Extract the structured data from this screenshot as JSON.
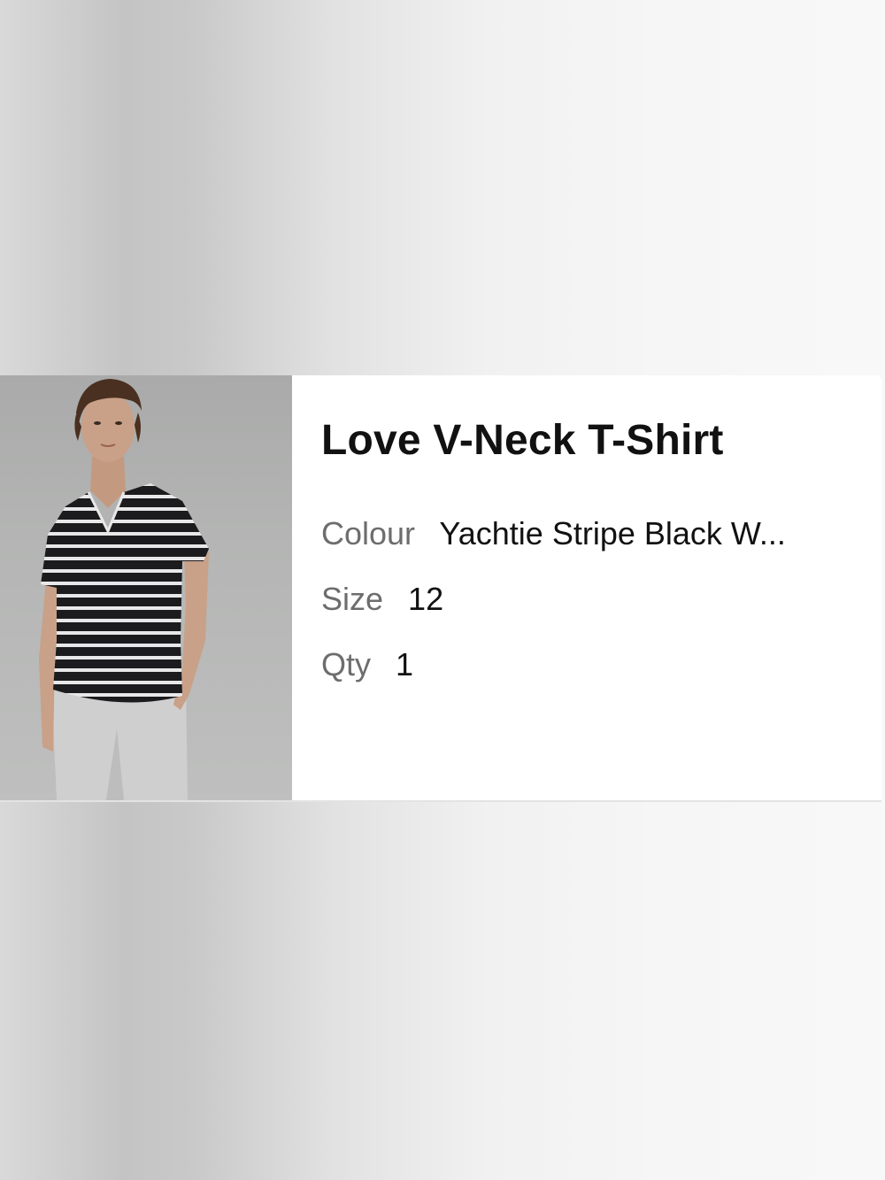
{
  "product": {
    "title": "Love V-Neck T-Shirt",
    "image_alt": "Model wearing striped v-neck t-shirt",
    "attributes": [
      {
        "label": "Colour",
        "value": "Yachtie Stripe Black W..."
      },
      {
        "label": "Size",
        "value": "12"
      },
      {
        "label": "Qty",
        "value": "1"
      }
    ]
  },
  "colors": {
    "card_background": "#ffffff",
    "label_text": "#6d6d6d",
    "value_text": "#111111"
  }
}
